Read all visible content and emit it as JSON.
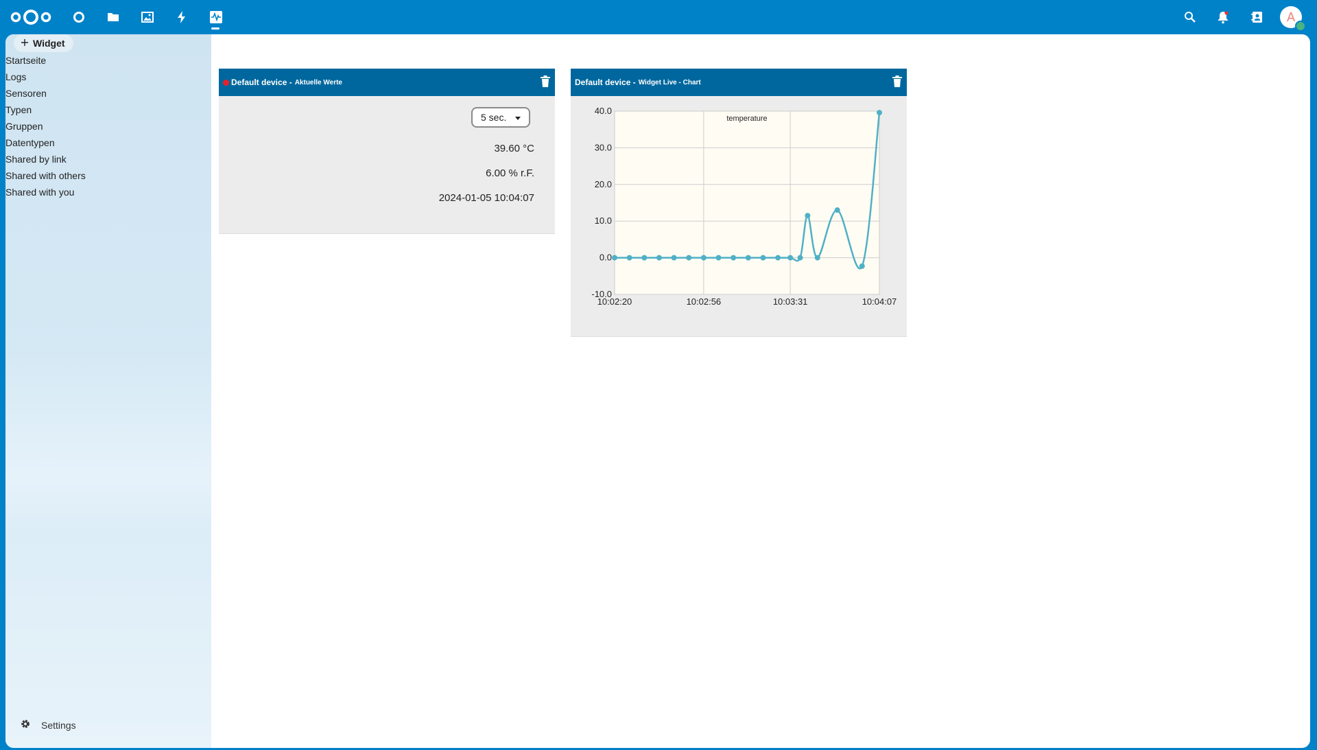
{
  "header": {
    "icons": [
      "nextcloud-logo-icon",
      "dashboard-icon",
      "files-icon",
      "photos-icon",
      "activity-icon",
      "sensor-app-icon"
    ],
    "right_icons": [
      "search-icon",
      "notifications-icon",
      "contacts-icon"
    ],
    "avatar_letter": "A"
  },
  "sidebar": {
    "add_widget_label": "Widget",
    "items": [
      {
        "label": "Startseite"
      },
      {
        "label": "Logs"
      },
      {
        "label": "Sensoren"
      },
      {
        "label": "Typen"
      },
      {
        "label": "Gruppen"
      },
      {
        "label": "Datentypen"
      },
      {
        "label": "Shared by link"
      },
      {
        "label": "Shared with others"
      },
      {
        "label": "Shared with you"
      }
    ],
    "settings_label": "Settings"
  },
  "widgets": {
    "current": {
      "device": "Default device -",
      "title": "Aktuelle Werte",
      "interval": "5 sec.",
      "temperature": "39.60 °C",
      "humidity": "6.00 % r.F.",
      "timestamp": "2024-01-05 10:04:07"
    },
    "chart": {
      "device": "Default device -",
      "title": "Widget Live - Chart"
    }
  },
  "colors": {
    "brand": "#0082c9",
    "widget_header": "#00679e",
    "line": "#4fb0c6",
    "status_dot": "#e8202a"
  },
  "chart_data": {
    "type": "line",
    "series": [
      {
        "name": "temperature",
        "values": [
          0,
          0,
          0,
          0,
          0,
          0,
          0,
          0,
          0,
          0,
          0,
          0,
          0,
          0,
          11.5,
          0,
          13,
          -2.3,
          39.6
        ]
      }
    ],
    "x": [
      "10:02:20",
      "10:02:26",
      "10:02:32",
      "10:02:38",
      "10:02:44",
      "10:02:50",
      "10:02:56",
      "10:03:02",
      "10:03:08",
      "10:03:14",
      "10:03:20",
      "10:03:26",
      "10:03:31",
      "10:03:35",
      "10:03:38",
      "10:03:42",
      "10:03:50",
      "10:04:00",
      "10:04:07"
    ],
    "x_ticks": [
      "10:02:20",
      "10:02:56",
      "10:03:31",
      "10:04:07"
    ],
    "y_ticks": [
      "40.0",
      "30.0",
      "20.0",
      "10.0",
      "0.0",
      "-10.0"
    ],
    "ylim": [
      -10,
      40
    ],
    "grid": true,
    "legend": "top-center"
  }
}
